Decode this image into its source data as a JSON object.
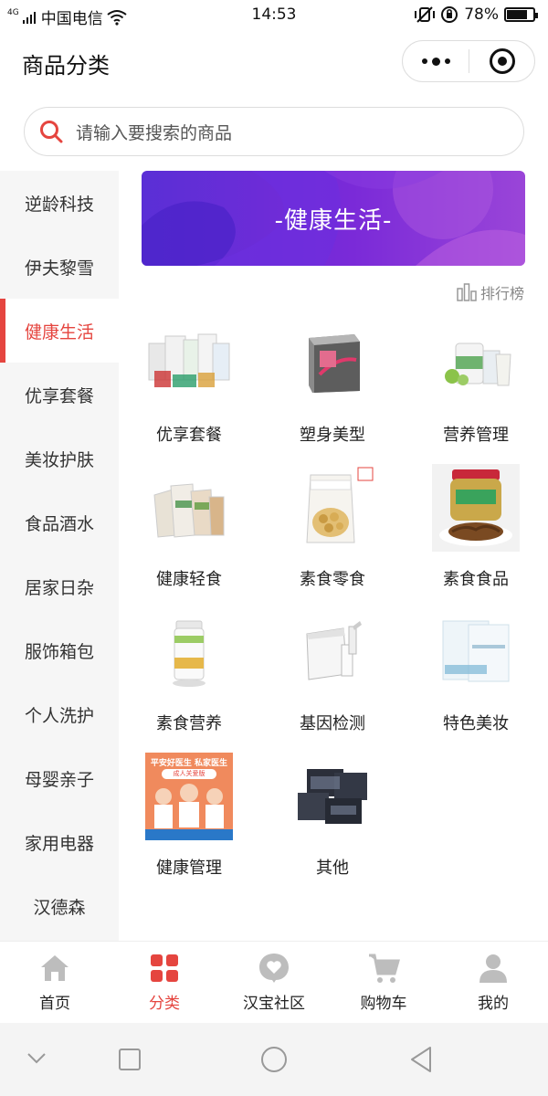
{
  "status": {
    "network": "4G",
    "carrier": "中国电信",
    "time": "14:53",
    "battery": "78%",
    "battery_level": 0.78
  },
  "header": {
    "title": "商品分类"
  },
  "search": {
    "placeholder": "请输入要搜索的商品"
  },
  "sidebar": {
    "items": [
      {
        "label": "逆龄科技",
        "active": false
      },
      {
        "label": "伊夫黎雪",
        "active": false
      },
      {
        "label": "健康生活",
        "active": true
      },
      {
        "label": "优享套餐",
        "active": false
      },
      {
        "label": "美妆护肤",
        "active": false
      },
      {
        "label": "食品酒水",
        "active": false
      },
      {
        "label": "居家日杂",
        "active": false
      },
      {
        "label": "服饰箱包",
        "active": false
      },
      {
        "label": "个人洗护",
        "active": false
      },
      {
        "label": "母婴亲子",
        "active": false
      },
      {
        "label": "家用电器",
        "active": false
      },
      {
        "label": "汉德森",
        "active": false
      }
    ]
  },
  "banner": {
    "text": "-健康生活-"
  },
  "ranking": {
    "label": "排行榜"
  },
  "products": [
    {
      "label": "优享套餐",
      "icon": "supplement-set-image"
    },
    {
      "label": "塑身美型",
      "icon": "box-image"
    },
    {
      "label": "营养管理",
      "icon": "nutrition-image"
    },
    {
      "label": "健康轻食",
      "icon": "light-food-image"
    },
    {
      "label": "素食零食",
      "icon": "snack-bag-image"
    },
    {
      "label": "素食食品",
      "icon": "jar-food-image"
    },
    {
      "label": "素食营养",
      "icon": "bottle-image"
    },
    {
      "label": "基因检测",
      "icon": "test-kit-image"
    },
    {
      "label": "特色美妆",
      "icon": "mask-pack-image"
    },
    {
      "label": "健康管理",
      "icon": "doctor-poster-image",
      "poster": {
        "line1": "平安好医生 私家医生",
        "line2": "成人关爱版"
      }
    },
    {
      "label": "其他",
      "icon": "bags-image"
    }
  ],
  "tabbar": {
    "items": [
      {
        "label": "首页",
        "icon": "home-icon",
        "active": false
      },
      {
        "label": "分类",
        "icon": "category-icon",
        "active": true
      },
      {
        "label": "汉宝社区",
        "icon": "community-heart-icon",
        "active": false
      },
      {
        "label": "购物车",
        "icon": "cart-icon",
        "active": false
      },
      {
        "label": "我的",
        "icon": "user-icon",
        "active": false
      }
    ]
  },
  "colors": {
    "accent": "#e5453f",
    "banner_start": "#5a2fd6",
    "banner_end": "#9a45d8",
    "sidebar_bg": "#f6f6f6"
  }
}
